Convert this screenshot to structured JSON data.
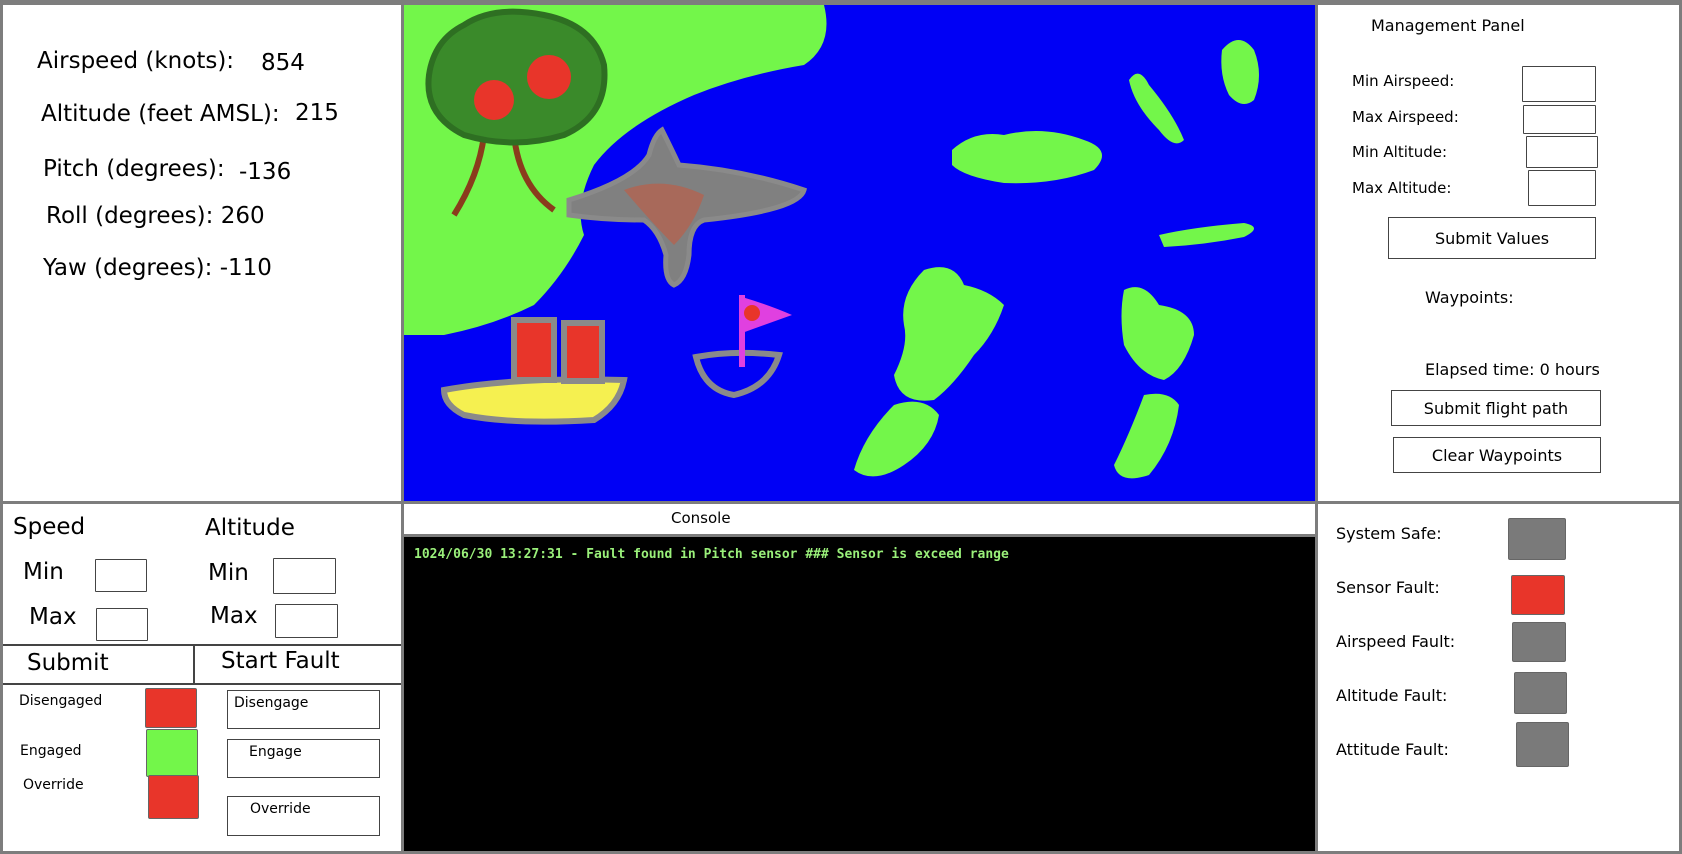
{
  "telemetry": {
    "airspeed_label": "Airspeed (knots):",
    "airspeed_value": "854",
    "altitude_label": "Altitude (feet AMSL):",
    "altitude_value": "215",
    "pitch_label": "Pitch (degrees):",
    "pitch_value": "-136",
    "roll_label": "Roll (degrees): 260",
    "yaw_label": "Yaw (degrees): -110"
  },
  "management": {
    "title": "Management Panel",
    "min_airspeed_label": "Min Airspeed:",
    "max_airspeed_label": "Max Airspeed:",
    "min_altitude_label": "Min Altitude:",
    "max_altitude_label": "Max Altitude:",
    "submit_values_label": "Submit Values",
    "waypoints_label": "Waypoints:",
    "elapsed_time": "Elapsed time: 0 hours",
    "submit_flight_path_label": "Submit flight path",
    "clear_waypoints_label": "Clear Waypoints"
  },
  "fault_controls": {
    "speed_label": "Speed",
    "altitude_label": "Altitude",
    "speed_min_label": "Min",
    "speed_max_label": "Max",
    "altitude_min_label": "Min",
    "altitude_max_label": "Max",
    "submit_label": "Submit",
    "start_fault_label": "Start Fault",
    "disengaged_label": "Disengaged",
    "engaged_label": "Engaged",
    "override_label": "Override",
    "disengage_button": "Disengage",
    "engage_button": "Engage",
    "override_button": "Override"
  },
  "console": {
    "title": "Console",
    "lines": [
      "1024/06/30 13:27:31 - Fault found in Pitch sensor ### Sensor is exceed range"
    ]
  },
  "status": {
    "system_safe_label": "System Safe:",
    "sensor_fault_label": "Sensor Fault:",
    "airspeed_fault_label": "Airspeed Fault:",
    "altitude_fault_label": "Altitude Fault:",
    "attitude_fault_label": "Attitude Fault:"
  },
  "colors": {
    "background": "#7d7d7d",
    "indicator_off": "#7a7a7a",
    "indicator_red": "#e8352a",
    "indicator_green": "#73f64a",
    "sea": "#0000f5",
    "land": "#73f64a",
    "console_text": "#9af07a"
  },
  "icons": {
    "map": "hand-drawn-map",
    "tree": "tree-icon",
    "aircraft": "aircraft-icon",
    "ship": "ship-icon",
    "sailboat": "sailboat-icon"
  }
}
